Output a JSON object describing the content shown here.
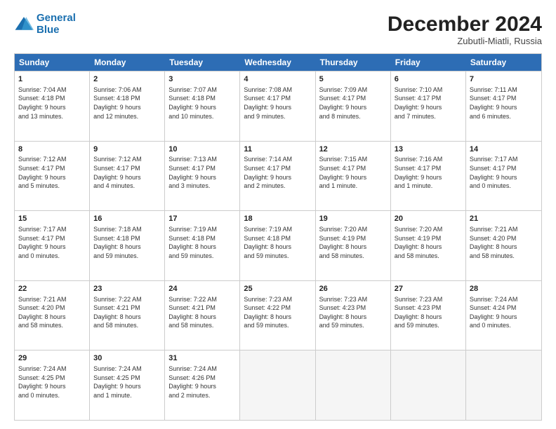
{
  "header": {
    "logo_line1": "General",
    "logo_line2": "Blue",
    "month_title": "December 2024",
    "subtitle": "Zubutli-Miatli, Russia"
  },
  "calendar": {
    "days_of_week": [
      "Sunday",
      "Monday",
      "Tuesday",
      "Wednesday",
      "Thursday",
      "Friday",
      "Saturday"
    ],
    "rows": [
      [
        {
          "day": "1",
          "lines": [
            "Sunrise: 7:04 AM",
            "Sunset: 4:18 PM",
            "Daylight: 9 hours",
            "and 13 minutes."
          ]
        },
        {
          "day": "2",
          "lines": [
            "Sunrise: 7:06 AM",
            "Sunset: 4:18 PM",
            "Daylight: 9 hours",
            "and 12 minutes."
          ]
        },
        {
          "day": "3",
          "lines": [
            "Sunrise: 7:07 AM",
            "Sunset: 4:18 PM",
            "Daylight: 9 hours",
            "and 10 minutes."
          ]
        },
        {
          "day": "4",
          "lines": [
            "Sunrise: 7:08 AM",
            "Sunset: 4:17 PM",
            "Daylight: 9 hours",
            "and 9 minutes."
          ]
        },
        {
          "day": "5",
          "lines": [
            "Sunrise: 7:09 AM",
            "Sunset: 4:17 PM",
            "Daylight: 9 hours",
            "and 8 minutes."
          ]
        },
        {
          "day": "6",
          "lines": [
            "Sunrise: 7:10 AM",
            "Sunset: 4:17 PM",
            "Daylight: 9 hours",
            "and 7 minutes."
          ]
        },
        {
          "day": "7",
          "lines": [
            "Sunrise: 7:11 AM",
            "Sunset: 4:17 PM",
            "Daylight: 9 hours",
            "and 6 minutes."
          ]
        }
      ],
      [
        {
          "day": "8",
          "lines": [
            "Sunrise: 7:12 AM",
            "Sunset: 4:17 PM",
            "Daylight: 9 hours",
            "and 5 minutes."
          ]
        },
        {
          "day": "9",
          "lines": [
            "Sunrise: 7:12 AM",
            "Sunset: 4:17 PM",
            "Daylight: 9 hours",
            "and 4 minutes."
          ]
        },
        {
          "day": "10",
          "lines": [
            "Sunrise: 7:13 AM",
            "Sunset: 4:17 PM",
            "Daylight: 9 hours",
            "and 3 minutes."
          ]
        },
        {
          "day": "11",
          "lines": [
            "Sunrise: 7:14 AM",
            "Sunset: 4:17 PM",
            "Daylight: 9 hours",
            "and 2 minutes."
          ]
        },
        {
          "day": "12",
          "lines": [
            "Sunrise: 7:15 AM",
            "Sunset: 4:17 PM",
            "Daylight: 9 hours",
            "and 1 minute."
          ]
        },
        {
          "day": "13",
          "lines": [
            "Sunrise: 7:16 AM",
            "Sunset: 4:17 PM",
            "Daylight: 9 hours",
            "and 1 minute."
          ]
        },
        {
          "day": "14",
          "lines": [
            "Sunrise: 7:17 AM",
            "Sunset: 4:17 PM",
            "Daylight: 9 hours",
            "and 0 minutes."
          ]
        }
      ],
      [
        {
          "day": "15",
          "lines": [
            "Sunrise: 7:17 AM",
            "Sunset: 4:17 PM",
            "Daylight: 9 hours",
            "and 0 minutes."
          ]
        },
        {
          "day": "16",
          "lines": [
            "Sunrise: 7:18 AM",
            "Sunset: 4:18 PM",
            "Daylight: 8 hours",
            "and 59 minutes."
          ]
        },
        {
          "day": "17",
          "lines": [
            "Sunrise: 7:19 AM",
            "Sunset: 4:18 PM",
            "Daylight: 8 hours",
            "and 59 minutes."
          ]
        },
        {
          "day": "18",
          "lines": [
            "Sunrise: 7:19 AM",
            "Sunset: 4:18 PM",
            "Daylight: 8 hours",
            "and 59 minutes."
          ]
        },
        {
          "day": "19",
          "lines": [
            "Sunrise: 7:20 AM",
            "Sunset: 4:19 PM",
            "Daylight: 8 hours",
            "and 58 minutes."
          ]
        },
        {
          "day": "20",
          "lines": [
            "Sunrise: 7:20 AM",
            "Sunset: 4:19 PM",
            "Daylight: 8 hours",
            "and 58 minutes."
          ]
        },
        {
          "day": "21",
          "lines": [
            "Sunrise: 7:21 AM",
            "Sunset: 4:20 PM",
            "Daylight: 8 hours",
            "and 58 minutes."
          ]
        }
      ],
      [
        {
          "day": "22",
          "lines": [
            "Sunrise: 7:21 AM",
            "Sunset: 4:20 PM",
            "Daylight: 8 hours",
            "and 58 minutes."
          ]
        },
        {
          "day": "23",
          "lines": [
            "Sunrise: 7:22 AM",
            "Sunset: 4:21 PM",
            "Daylight: 8 hours",
            "and 58 minutes."
          ]
        },
        {
          "day": "24",
          "lines": [
            "Sunrise: 7:22 AM",
            "Sunset: 4:21 PM",
            "Daylight: 8 hours",
            "and 58 minutes."
          ]
        },
        {
          "day": "25",
          "lines": [
            "Sunrise: 7:23 AM",
            "Sunset: 4:22 PM",
            "Daylight: 8 hours",
            "and 59 minutes."
          ]
        },
        {
          "day": "26",
          "lines": [
            "Sunrise: 7:23 AM",
            "Sunset: 4:23 PM",
            "Daylight: 8 hours",
            "and 59 minutes."
          ]
        },
        {
          "day": "27",
          "lines": [
            "Sunrise: 7:23 AM",
            "Sunset: 4:23 PM",
            "Daylight: 8 hours",
            "and 59 minutes."
          ]
        },
        {
          "day": "28",
          "lines": [
            "Sunrise: 7:24 AM",
            "Sunset: 4:24 PM",
            "Daylight: 9 hours",
            "and 0 minutes."
          ]
        }
      ],
      [
        {
          "day": "29",
          "lines": [
            "Sunrise: 7:24 AM",
            "Sunset: 4:25 PM",
            "Daylight: 9 hours",
            "and 0 minutes."
          ]
        },
        {
          "day": "30",
          "lines": [
            "Sunrise: 7:24 AM",
            "Sunset: 4:25 PM",
            "Daylight: 9 hours",
            "and 1 minute."
          ]
        },
        {
          "day": "31",
          "lines": [
            "Sunrise: 7:24 AM",
            "Sunset: 4:26 PM",
            "Daylight: 9 hours",
            "and 2 minutes."
          ]
        },
        {
          "day": "",
          "lines": []
        },
        {
          "day": "",
          "lines": []
        },
        {
          "day": "",
          "lines": []
        },
        {
          "day": "",
          "lines": []
        }
      ]
    ]
  }
}
